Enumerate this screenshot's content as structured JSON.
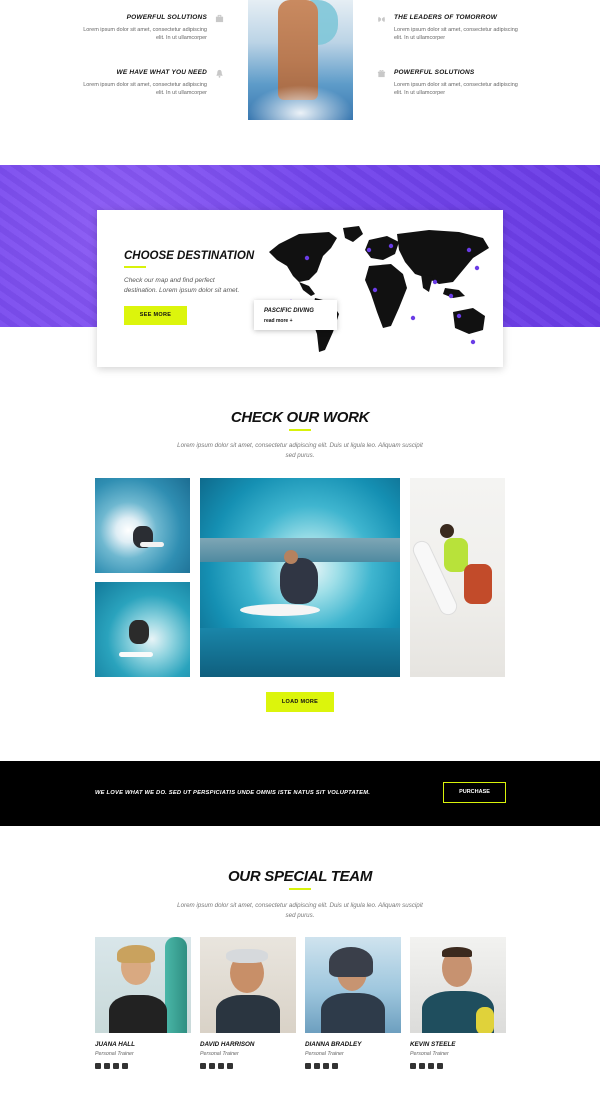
{
  "features": {
    "left": [
      {
        "title": "Powerful Solutions",
        "text": "Lorem ipsum dolor sit amet, consectetur adipiscing elit. In ut ullamcorper",
        "icon": "briefcase-icon"
      },
      {
        "title": "We Have What You Need",
        "text": "Lorem ipsum dolor sit amet, consectetur adipiscing elit. In ut ullamcorper",
        "icon": "bell-icon"
      }
    ],
    "right": [
      {
        "title": "The Leaders of Tomorrow",
        "text": "Lorem ipsum dolor sit amet, consectetur adipiscing elit. In ut ullamcorper",
        "icon": "lungs-icon"
      },
      {
        "title": "Powerful Solutions",
        "text": "Lorem ipsum dolor sit amet, consectetur adipiscing elit. In ut ullamcorper",
        "icon": "gift-icon"
      }
    ]
  },
  "destination": {
    "title": "Choose Destination",
    "text": "Check our map and find perfect destination. Lorem ipsum dolor sit amet.",
    "button": "See More",
    "popup_title": "Pascific Diving",
    "popup_link": "read more +"
  },
  "work": {
    "title": "Check Our Work",
    "subtitle": "Lorem ipsum dolor sit amet, consectetur adipiscing elit. Duis ut ligula leo. Aliquam suscipit sed purus.",
    "button": "Load More"
  },
  "banner": {
    "text": "We love what we do. Sed ut perspiciatis unde omnis iste natus sit voluptatem.",
    "button": "Purchase"
  },
  "team": {
    "title": "Our Special Team",
    "subtitle": "Lorem ipsum dolor sit amet, consectetur adipiscing elit. Duis ut ligula leo. Aliquam suscipit sed purus.",
    "members": [
      {
        "name": "Juana Hall",
        "role": "Personal Trainer"
      },
      {
        "name": "David Harrison",
        "role": "Personal Trainer"
      },
      {
        "name": "Dianna Bradley",
        "role": "Personal Trainer"
      },
      {
        "name": "Kevin Steele",
        "role": "Personal Trainer"
      }
    ],
    "social_icons": [
      "email-icon",
      "youtube-icon",
      "facebook-icon",
      "twitter-icon"
    ]
  },
  "colors": {
    "accent": "#dcf50c",
    "purple": "#7446ec",
    "dark": "#000000"
  }
}
